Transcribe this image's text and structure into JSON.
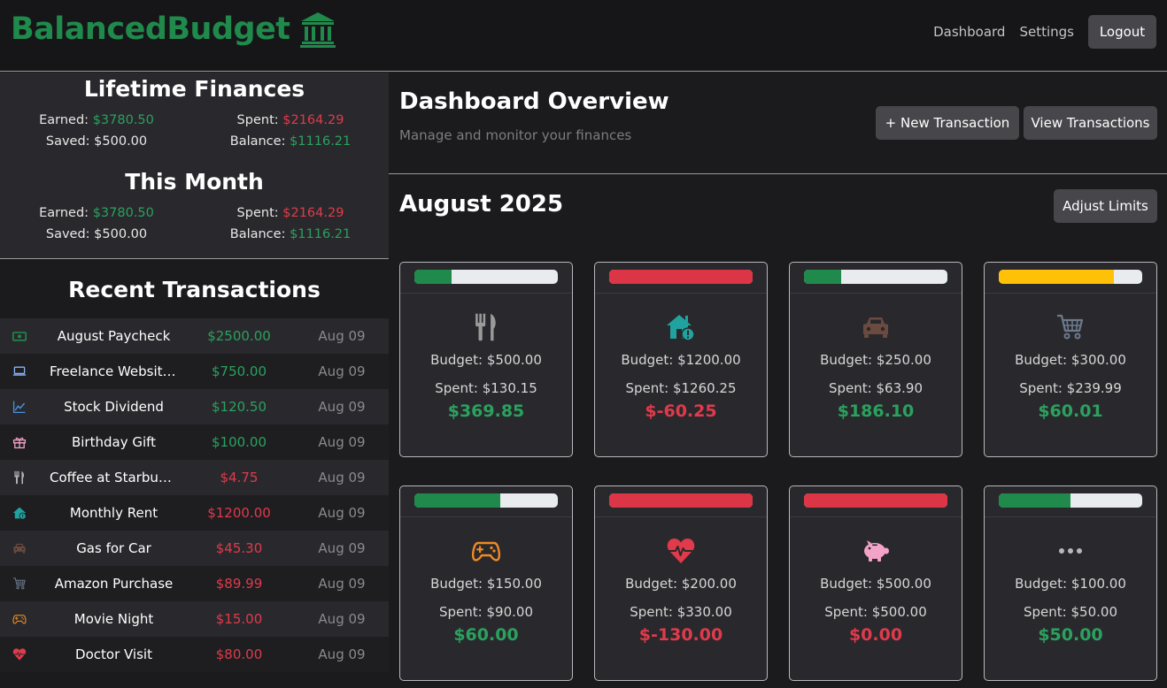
{
  "app": {
    "brand": "BalancedBudget",
    "brand_icon": "bank-icon",
    "nav": {
      "dashboard": "Dashboard",
      "settings": "Settings",
      "logout": "Logout"
    }
  },
  "colors": {
    "brand_green": "#1f8a4c",
    "income_green": "#2aa15e",
    "expense_red": "#e03a4b",
    "warning_yellow": "#ffc107",
    "button_gray": "#47474b"
  },
  "lifetime": {
    "title": "Lifetime Finances",
    "earned_label": "Earned:",
    "earned": "$3780.50",
    "spent_label": "Spent:",
    "spent": "$2164.29",
    "saved_label": "Saved:",
    "saved": "$500.00",
    "balance_label": "Balance:",
    "balance": "$1116.21"
  },
  "this_month": {
    "title": "This Month",
    "earned_label": "Earned:",
    "earned": "$3780.50",
    "spent_label": "Spent:",
    "spent": "$2164.29",
    "saved_label": "Saved:",
    "saved": "$500.00",
    "balance_label": "Balance:",
    "balance": "$1116.21"
  },
  "recent": {
    "title": "Recent Transactions",
    "items": [
      {
        "icon": "money-bill-icon",
        "icon_color": "#1f8a4c",
        "name": "August Paycheck",
        "amount": "$2500.00",
        "type": "income",
        "date": "Aug 09"
      },
      {
        "icon": "laptop-icon",
        "icon_color": "#8ab4f8",
        "name": "Freelance Website...",
        "amount": "$750.00",
        "type": "income",
        "date": "Aug 09"
      },
      {
        "icon": "chart-line-icon",
        "icon_color": "#4a90e2",
        "name": "Stock Dividend",
        "amount": "$120.50",
        "type": "income",
        "date": "Aug 09"
      },
      {
        "icon": "gift-icon",
        "icon_color": "#f4a3c8",
        "name": "Birthday Gift",
        "amount": "$100.00",
        "type": "income",
        "date": "Aug 09"
      },
      {
        "icon": "utensils-icon",
        "icon_color": "#b0b0b0",
        "name": "Coffee at Starbucks",
        "amount": "$4.75",
        "type": "expense",
        "date": "Aug 09"
      },
      {
        "icon": "house-icon",
        "icon_color": "#20a39e",
        "name": "Monthly Rent",
        "amount": "$1200.00",
        "type": "expense",
        "date": "Aug 09"
      },
      {
        "icon": "car-icon",
        "icon_color": "#6b4a40",
        "name": "Gas for Car",
        "amount": "$45.30",
        "type": "expense",
        "date": "Aug 09"
      },
      {
        "icon": "cart-icon",
        "icon_color": "#6c7a8c",
        "name": "Amazon Purchase",
        "amount": "$89.99",
        "type": "expense",
        "date": "Aug 09"
      },
      {
        "icon": "gamepad-icon",
        "icon_color": "#f08a24",
        "name": "Movie Night",
        "amount": "$15.00",
        "type": "expense",
        "date": "Aug 09"
      },
      {
        "icon": "heart-pulse-icon",
        "icon_color": "#e03a4b",
        "name": "Doctor Visit",
        "amount": "$80.00",
        "type": "expense",
        "date": "Aug 09"
      }
    ]
  },
  "overview": {
    "title": "Dashboard Overview",
    "subtitle": "Manage and monitor your finances",
    "new_tx_label": "+  New Transaction",
    "view_tx_label": "View Transactions"
  },
  "month": {
    "title": "August 2025",
    "adjust_label": "Adjust Limits"
  },
  "budgets": [
    {
      "icon": "utensils-icon",
      "icon_color": "#9a9a9a",
      "budget": "Budget: $500.00",
      "spent": "Spent: $130.15",
      "remaining": "$369.85",
      "status": "ok",
      "progress": 0.26,
      "bar_color": "#1f8a4c"
    },
    {
      "icon": "house-alert-icon",
      "icon_color": "#20a39e",
      "budget": "Budget: $1200.00",
      "spent": "Spent: $1260.25",
      "remaining": "$-60.25",
      "status": "over",
      "progress": 1.0,
      "bar_color": "#dc3545"
    },
    {
      "icon": "car-icon",
      "icon_color": "#6b4a40",
      "budget": "Budget: $250.00",
      "spent": "Spent: $63.90",
      "remaining": "$186.10",
      "status": "ok",
      "progress": 0.26,
      "bar_color": "#1f8a4c"
    },
    {
      "icon": "cart-icon",
      "icon_color": "#6c7a8c",
      "budget": "Budget: $300.00",
      "spent": "Spent: $239.99",
      "remaining": "$60.01",
      "status": "ok",
      "progress": 0.8,
      "bar_color": "#ffc107"
    },
    {
      "icon": "gamepad-icon",
      "icon_color": "#f08a24",
      "budget": "Budget: $150.00",
      "spent": "Spent: $90.00",
      "remaining": "$60.00",
      "status": "ok",
      "progress": 0.6,
      "bar_color": "#1f8a4c"
    },
    {
      "icon": "heart-pulse-icon",
      "icon_color": "#e03a4b",
      "budget": "Budget: $200.00",
      "spent": "Spent: $330.00",
      "remaining": "$-130.00",
      "status": "over",
      "progress": 1.0,
      "bar_color": "#dc3545"
    },
    {
      "icon": "piggy-bank-icon",
      "icon_color": "#f4a3c8",
      "budget": "Budget: $500.00",
      "spent": "Spent: $500.00",
      "remaining": "$0.00",
      "status": "over",
      "progress": 1.0,
      "bar_color": "#dc3545"
    },
    {
      "icon": "ellipsis-icon",
      "icon_color": "#b8b8b8",
      "budget": "Budget: $100.00",
      "spent": "Spent: $50.00",
      "remaining": "$50.00",
      "status": "ok",
      "progress": 0.5,
      "bar_color": "#1f8a4c"
    }
  ]
}
